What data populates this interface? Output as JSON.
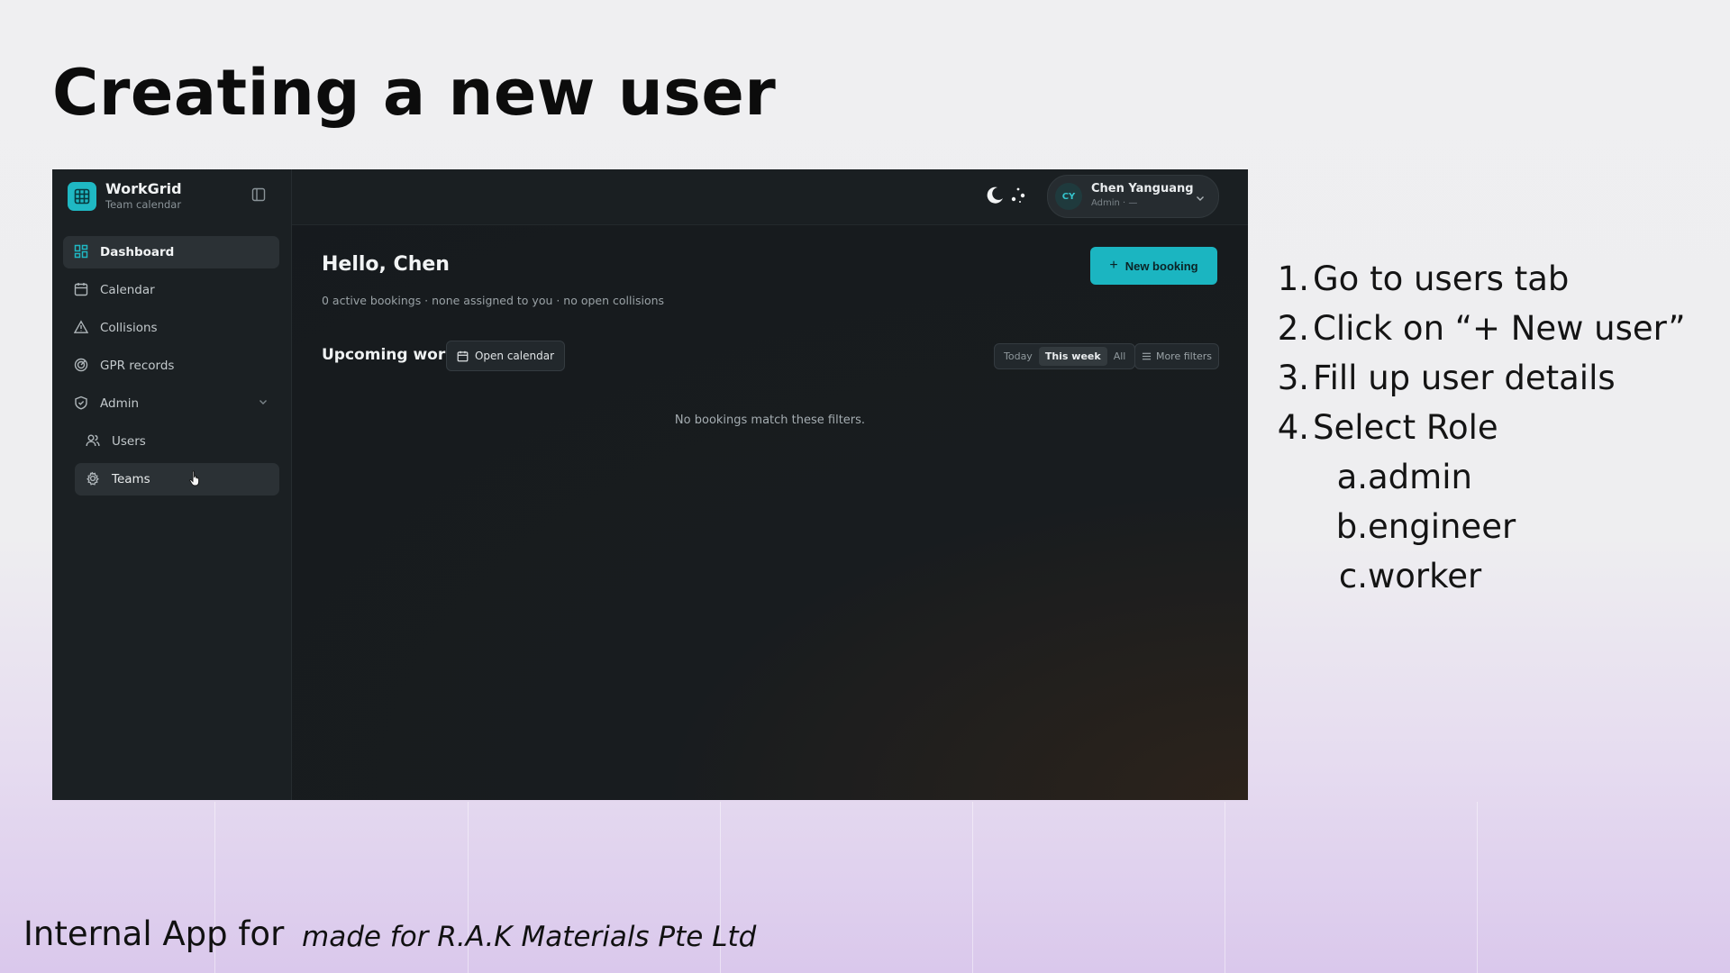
{
  "slide": {
    "title": "Creating a new user",
    "footer_left": "Internal App for",
    "footer_right": "made for R.A.K Materials Pte Ltd"
  },
  "app": {
    "brand": {
      "name": "WorkGrid",
      "subtitle": "Team calendar"
    },
    "sidebar": {
      "items": [
        {
          "label": "Dashboard",
          "icon": "dashboard-icon",
          "active": true
        },
        {
          "label": "Calendar",
          "icon": "calendar-icon"
        },
        {
          "label": "Collisions",
          "icon": "warning-triangle-icon"
        },
        {
          "label": "GPR records",
          "icon": "radar-icon"
        },
        {
          "label": "Admin",
          "icon": "shield-icon",
          "expandable": true
        }
      ],
      "admin_items": [
        {
          "label": "Users",
          "icon": "users-icon"
        },
        {
          "label": "Teams",
          "icon": "gear-icon",
          "hovered": true
        }
      ]
    },
    "topbar": {
      "user": {
        "initials": "CY",
        "name": "Chen Yanguang",
        "role": "Admin · —"
      }
    },
    "main": {
      "greeting": "Hello, Chen",
      "summary": "0 active bookings · none assigned to you · no open collisions",
      "new_booking_label": "New booking",
      "section_title": "Upcoming work",
      "open_calendar_label": "Open calendar",
      "filters": [
        "Today",
        "This week",
        "All"
      ],
      "active_filter": "This week",
      "more_filters_label": "More filters",
      "empty_message": "No bookings match these filters."
    },
    "colors": {
      "accent": "#1bb5c1",
      "background": "#161a1d",
      "sidebar": "#1b2023"
    }
  },
  "instructions": {
    "steps": [
      {
        "num": "1.",
        "text": "Go to users tab"
      },
      {
        "num": "2.",
        "text": "Click on “+ New user”"
      },
      {
        "num": "3.",
        "text": "Fill up user details"
      },
      {
        "num": "4.",
        "text": "Select Role"
      }
    ],
    "roles": [
      {
        "num": "a.",
        "text": "admin"
      },
      {
        "num": "b.",
        "text": "engineer"
      },
      {
        "num": "c.",
        "text": "worker"
      }
    ]
  }
}
